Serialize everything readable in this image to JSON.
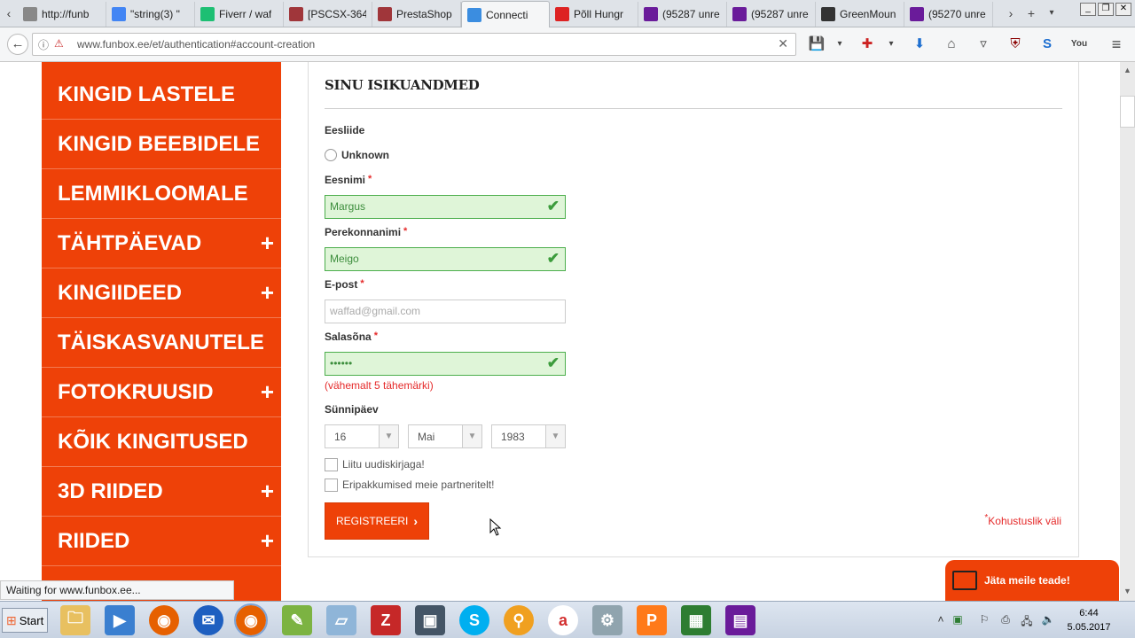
{
  "browser": {
    "tabs": [
      {
        "title": "http://funb",
        "icon": "page-icon",
        "color": "#888888"
      },
      {
        "title": "\"string(3) \"",
        "icon": "google-icon",
        "color": "#4285f4"
      },
      {
        "title": "Fiverr / waf",
        "icon": "fiverr-icon",
        "color": "#1dbf73"
      },
      {
        "title": "[PSCSX-364",
        "icon": "prestashop-icon",
        "color": "#a0363a"
      },
      {
        "title": "PrestaShop",
        "icon": "prestashop-icon",
        "color": "#a0363a"
      },
      {
        "title": "Connecti",
        "icon": "loading-icon",
        "color": "#3b8de0",
        "active": true
      },
      {
        "title": "Põll Hungr",
        "icon": "bookmark-icon",
        "color": "#d22"
      },
      {
        "title": "(95287 unre",
        "icon": "mail-icon",
        "color": "#6a1b9a"
      },
      {
        "title": "(95287 unre",
        "icon": "mail-icon",
        "color": "#6a1b9a"
      },
      {
        "title": "GreenMoun",
        "icon": "greenmountain-icon",
        "color": "#333333"
      },
      {
        "title": "(95270 unre",
        "icon": "mail-icon",
        "color": "#6a1b9a"
      }
    ],
    "url": "www.funbox.ee/et/authentication#account-creation",
    "status": "Waiting for www.funbox.ee..."
  },
  "sidebar": {
    "items": [
      {
        "label": "KINGID LASTELE",
        "expandable": false
      },
      {
        "label": "KINGID BEEBIDELE",
        "expandable": false
      },
      {
        "label": "LEMMIKLOOMALE",
        "expandable": false
      },
      {
        "label": "TÄHTPÄEVAD",
        "expandable": true
      },
      {
        "label": "KINGIIDEED",
        "expandable": true
      },
      {
        "label": "TÄISKASVANUTELE",
        "expandable": false
      },
      {
        "label": "FOTOKRUUSID",
        "expandable": true
      },
      {
        "label": "KÕIK KINGITUSED",
        "expandable": false
      },
      {
        "label": "3D RIIDED",
        "expandable": true
      },
      {
        "label": "RIIDED",
        "expandable": true
      }
    ]
  },
  "form": {
    "title": "SINU ISIKUANDMED",
    "title_label": "Eesliide",
    "title_option": "Unknown",
    "firstname_label": "Eesnimi",
    "firstname_value": "Margus",
    "lastname_label": "Perekonnanimi",
    "lastname_value": "Meigo",
    "email_label": "E-post",
    "email_placeholder": "waffad@gmail.com",
    "password_label": "Salasõna",
    "password_value": "••••••",
    "password_hint": "(vähemalt 5 tähemärki)",
    "birthday_label": "Sünnipäev",
    "birth_day": "16",
    "birth_month": "Mai",
    "birth_year": "1983",
    "newsletter_label": "Liitu uudiskirjaga!",
    "offers_label": "Eripakkumised meie partneritelt!",
    "register_label": "REGISTREERI",
    "required_star": "*",
    "required_note": "Kohustuslik väli"
  },
  "chat": {
    "label": "Jäta meile teade!"
  },
  "taskbar": {
    "start_label": "Start",
    "time": "6:44",
    "date": "5.05.2017"
  }
}
